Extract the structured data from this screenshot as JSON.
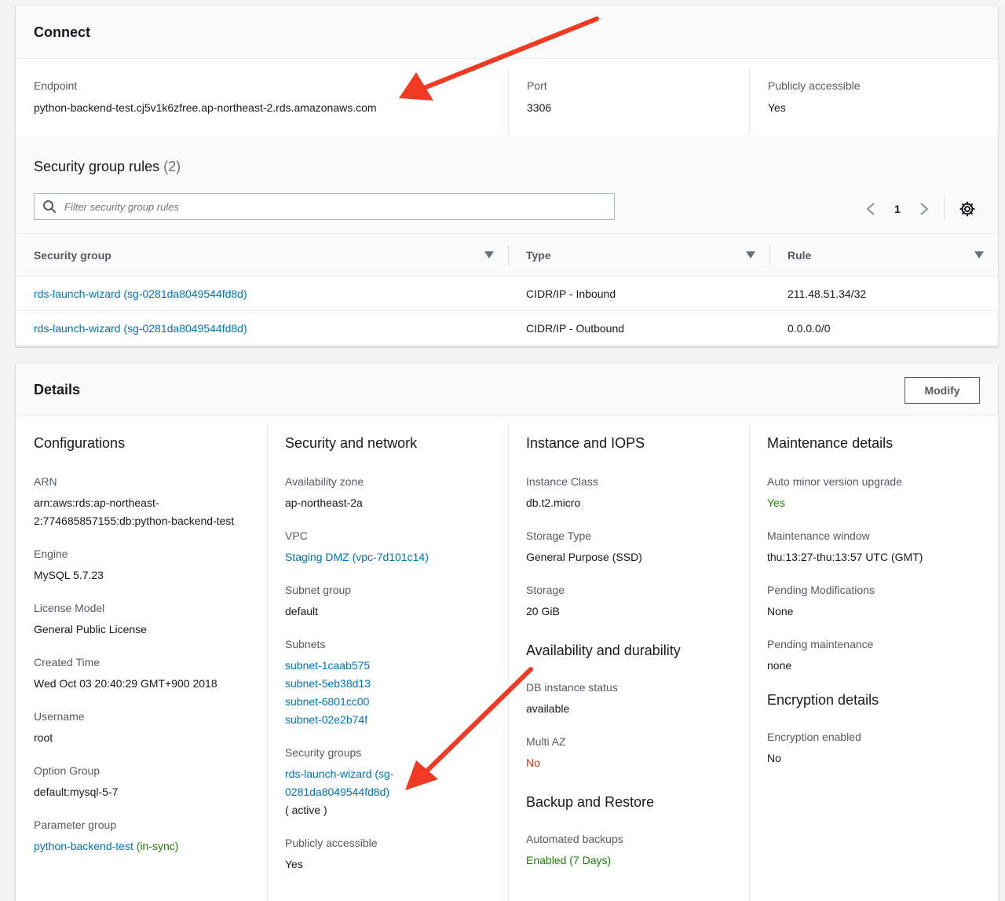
{
  "connect": {
    "title": "Connect",
    "endpoint_label": "Endpoint",
    "endpoint_value": "python-backend-test.cj5v1k6zfree.ap-northeast-2.rds.amazonaws.com",
    "port_label": "Port",
    "port_value": "3306",
    "public_label": "Publicly accessible",
    "public_value": "Yes"
  },
  "sg_rules": {
    "title": "Security group rules",
    "count": "(2)",
    "filter_placeholder": "Filter security group rules",
    "page": "1",
    "columns": [
      "Security group",
      "Type",
      "Rule"
    ],
    "rows": [
      {
        "group": "rds-launch-wizard (sg-0281da8049544fd8d)",
        "type": "CIDR/IP - Inbound",
        "rule": "211.48.51.34/32"
      },
      {
        "group": "rds-launch-wizard (sg-0281da8049544fd8d)",
        "type": "CIDR/IP - Outbound",
        "rule": "0.0.0.0/0"
      }
    ]
  },
  "details": {
    "title": "Details",
    "modify_label": "Modify",
    "configurations": {
      "heading": "Configurations",
      "arn_label": "ARN",
      "arn_line1": "arn:aws:rds:ap-northeast-",
      "arn_line2": "2:774685857155:db:python-backend-test",
      "engine_label": "Engine",
      "engine_value": "MySQL 5.7.23",
      "license_label": "License Model",
      "license_value": "General Public License",
      "created_label": "Created Time",
      "created_value": "Wed Oct 03 20:40:29 GMT+900 2018",
      "username_label": "Username",
      "username_value": "root",
      "option_label": "Option Group",
      "option_value": "default:mysql-5-7",
      "param_label": "Parameter group",
      "param_value": "python-backend-test",
      "param_status": "(in-sync)"
    },
    "security": {
      "heading": "Security and network",
      "az_label": "Availability zone",
      "az_value": "ap-northeast-2a",
      "vpc_label": "VPC",
      "vpc_value": "Staging DMZ (vpc-7d101c14)",
      "subnet_group_label": "Subnet group",
      "subnet_group_value": "default",
      "subnets_label": "Subnets",
      "subnets": [
        "subnet-1caab575",
        "subnet-5eb38d13",
        "subnet-6801cc00",
        "subnet-02e2b74f"
      ],
      "sg_label": "Security groups",
      "sg_line1": "rds-launch-wizard (sg-",
      "sg_line2": "0281da8049544fd8d)",
      "sg_status": "( active )",
      "public_label": "Publicly accessible",
      "public_value": "Yes"
    },
    "instance": {
      "heading": "Instance and IOPS",
      "class_label": "Instance Class",
      "class_value": "db.t2.micro",
      "storage_type_label": "Storage Type",
      "storage_type_value": "General Purpose (SSD)",
      "storage_label": "Storage",
      "storage_value": "20 GiB",
      "avail_heading": "Availability and durability",
      "status_label": "DB instance status",
      "status_value": "available",
      "multiaz_label": "Multi AZ",
      "multiaz_value": "No",
      "backup_heading": "Backup and Restore",
      "auto_backup_label": "Automated backups",
      "auto_backup_value": "Enabled (7 Days)"
    },
    "maintenance": {
      "heading": "Maintenance details",
      "auto_minor_label": "Auto minor version upgrade",
      "auto_minor_value": "Yes",
      "window_label": "Maintenance window",
      "window_value": "thu:13:27-thu:13:57 UTC (GMT)",
      "pending_mod_label": "Pending Modifications",
      "pending_mod_value": "None",
      "pending_maint_label": "Pending maintenance",
      "pending_maint_value": "none",
      "enc_heading": "Encryption details",
      "enc_label": "Encryption enabled",
      "enc_value": "No"
    }
  },
  "colors": {
    "link": "#0073bb",
    "green": "#1d8102",
    "red": "#d13212",
    "arrow": "#f03a24"
  }
}
